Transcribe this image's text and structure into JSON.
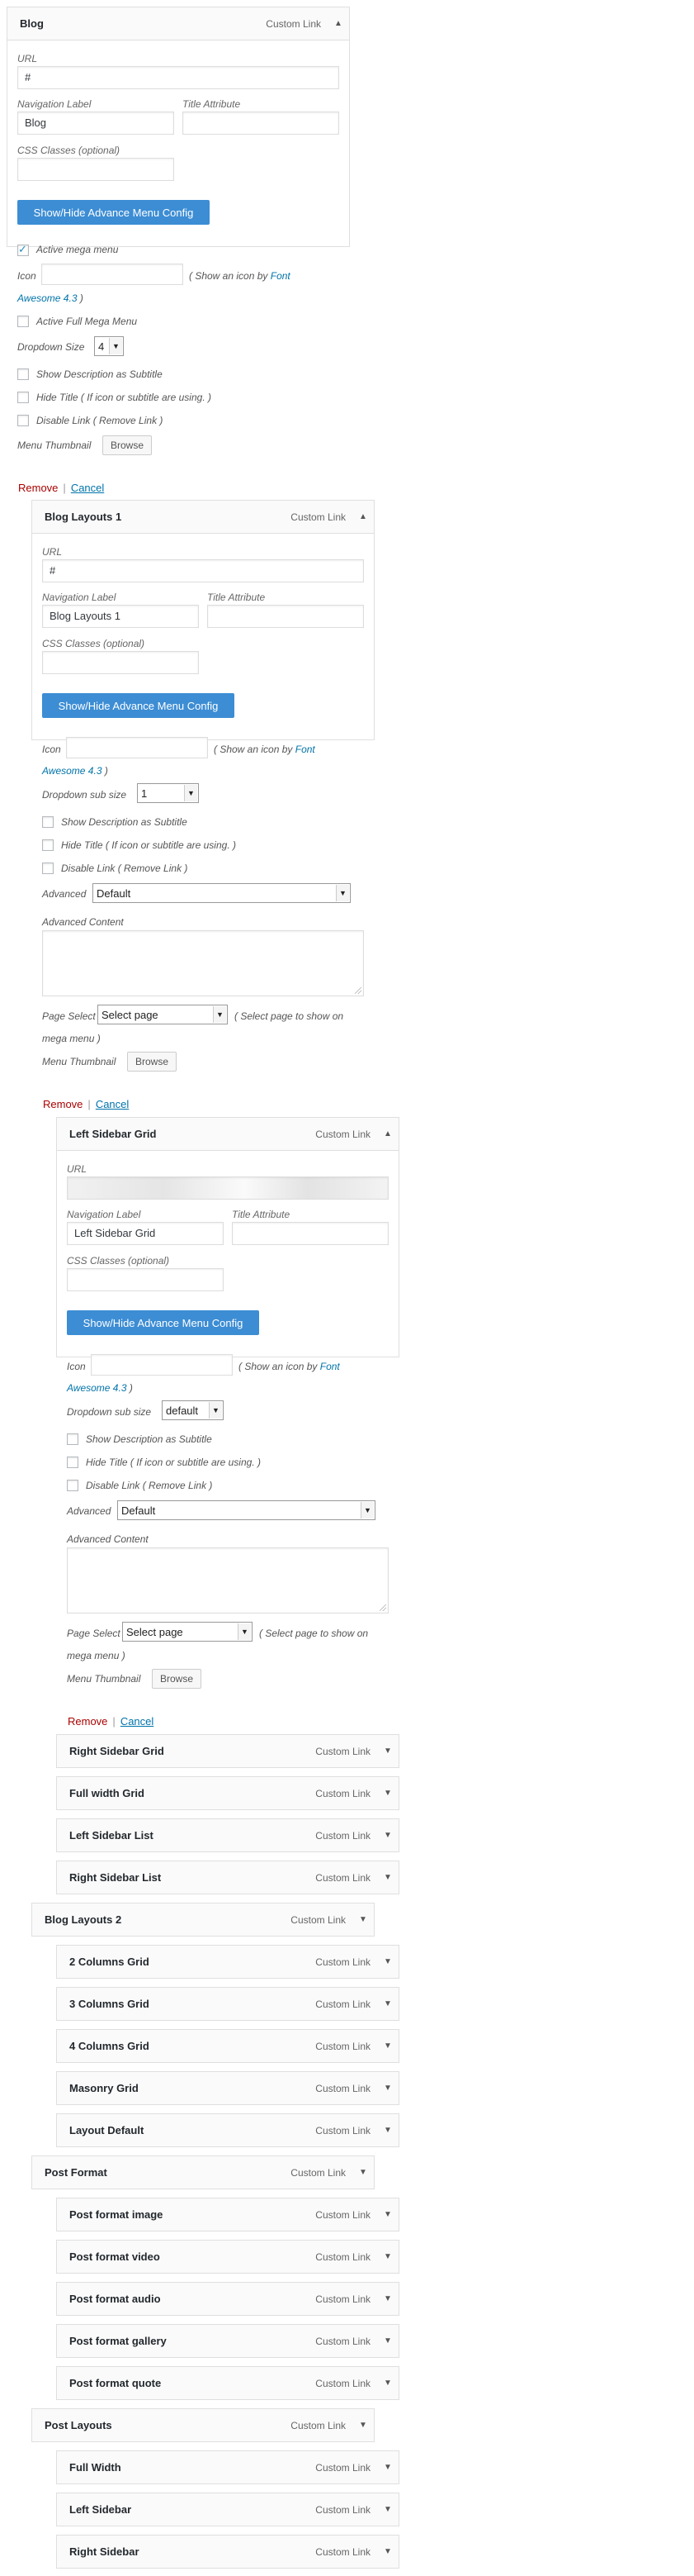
{
  "labels": {
    "custom_link": "Custom Link",
    "url": "URL",
    "navigation_label": "Navigation Label",
    "title_attribute": "Title Attribute",
    "css_classes": "CSS Classes (optional)",
    "advance_button": "Show/Hide Advance Menu Config",
    "active_mega_menu": "Active mega menu",
    "icon": "Icon",
    "icon_hint_pre": "( Show an icon by",
    "icon_hint_font": "Font",
    "icon_hint_awesome": "Awesome 4.3",
    "icon_hint_post": ")",
    "active_full_mega": "Active Full Mega Menu",
    "dropdown_size": "Dropdown Size",
    "dropdown_sub_size": "Dropdown sub size",
    "show_description": "Show Description as Subtitle",
    "hide_title": "Hide Title ( If icon or subtitle are using. )",
    "disable_link": "Disable Link ( Remove Link )",
    "menu_thumbnail": "Menu Thumbnail",
    "browse": "Browse",
    "advanced": "Advanced",
    "advanced_content": "Advanced Content",
    "page_select": "Page Select",
    "page_select_hint1": "( Select page to show on",
    "page_select_hint2": "mega menu )",
    "remove": "Remove",
    "cancel": "Cancel",
    "sep": "|"
  },
  "blog": {
    "title": "Blog",
    "url_value": "#",
    "nav_value": "Blog",
    "title_value": "",
    "css_value": "",
    "active_mega_checked": true,
    "dropdown_size_value": "4"
  },
  "blog_layouts_1": {
    "title": "Blog Layouts 1",
    "url_value": "#",
    "nav_value": "Blog Layouts 1",
    "dropdown_sub_value": "1",
    "advanced_value": "Default",
    "page_select_value": "Select page"
  },
  "left_sidebar_grid": {
    "title": "Left Sidebar Grid",
    "nav_value": "Left Sidebar Grid",
    "dropdown_sub_value": "default",
    "advanced_value": "Default",
    "page_select_value": "Select page"
  },
  "collapsed_items": [
    {
      "title": "Right Sidebar Grid"
    },
    {
      "title": "Full width Grid"
    },
    {
      "title": "Left Sidebar List"
    },
    {
      "title": "Right Sidebar List"
    },
    {
      "title": "Blog Layouts 2"
    },
    {
      "title": "2 Columns Grid"
    },
    {
      "title": "3 Columns Grid"
    },
    {
      "title": "4 Columns Grid"
    },
    {
      "title": "Masonry Grid"
    },
    {
      "title": "Layout Default"
    },
    {
      "title": "Post Format"
    },
    {
      "title": "Post format image"
    },
    {
      "title": "Post format video"
    },
    {
      "title": "Post format audio"
    },
    {
      "title": "Post format gallery"
    },
    {
      "title": "Post format quote"
    },
    {
      "title": "Post Layouts"
    },
    {
      "title": "Full Width"
    },
    {
      "title": "Left Sidebar"
    },
    {
      "title": "Right Sidebar"
    }
  ]
}
